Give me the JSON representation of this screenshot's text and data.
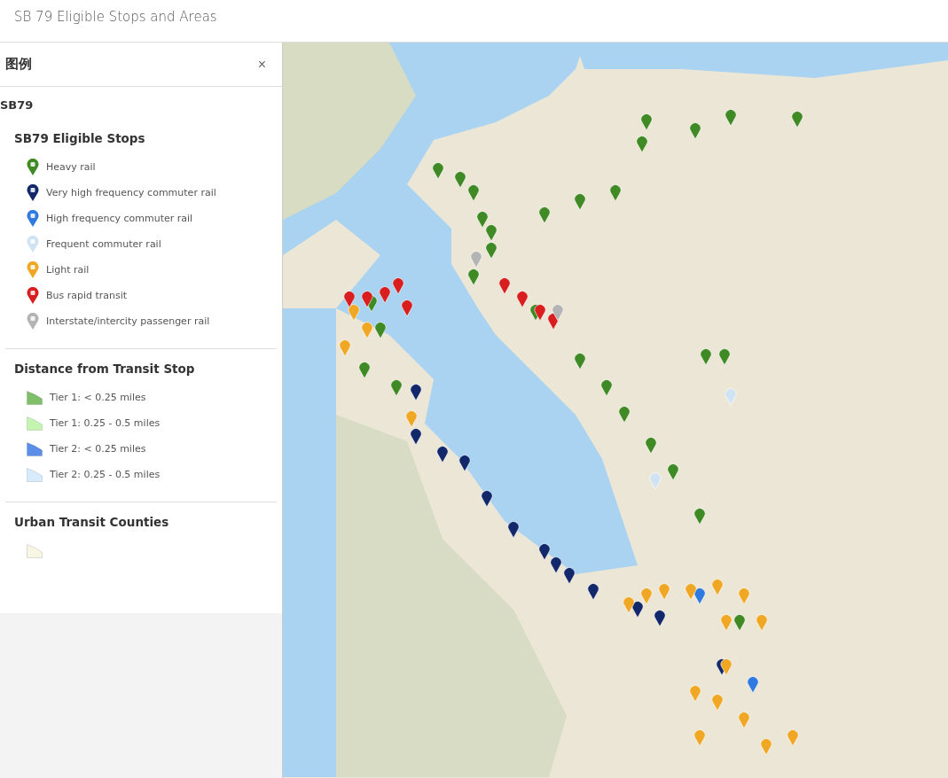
{
  "app_title": "SB 79 Eligible Stops and Areas",
  "legend": {
    "title": "图例",
    "close": "×",
    "layer": "SB79",
    "sections": [
      {
        "title": "SB79 Eligible Stops",
        "items": [
          {
            "kind": "pin",
            "label": "Heavy rail",
            "color": "#3f8a25"
          },
          {
            "kind": "pin",
            "label": "Very high frequency commuter rail",
            "color": "#12286b"
          },
          {
            "kind": "pin",
            "label": "High frequency commuter rail",
            "color": "#2f7ae0"
          },
          {
            "kind": "pin",
            "label": "Frequent commuter rail",
            "color": "#cfe3f2"
          },
          {
            "kind": "pin",
            "label": "Light rail",
            "color": "#f0a824"
          },
          {
            "kind": "pin",
            "label": "Bus rapid transit",
            "color": "#d81e1e"
          },
          {
            "kind": "pin",
            "label": "Interstate/intercity passenger rail",
            "color": "#b4b4b4"
          }
        ]
      },
      {
        "title": "Distance from Transit Stop",
        "items": [
          {
            "kind": "area",
            "label": "Tier 1: < 0.25 miles",
            "color": "#7fbf6a"
          },
          {
            "kind": "area",
            "label": "Tier 1: 0.25 - 0.5 miles",
            "color": "#c3f5b0"
          },
          {
            "kind": "area",
            "label": "Tier 2: < 0.25 miles",
            "color": "#5b8ee8"
          },
          {
            "kind": "area",
            "label": "Tier 2: 0.25 - 0.5 miles",
            "color": "#d6ebfb"
          }
        ]
      },
      {
        "title": "Urban Transit Counties",
        "items": [
          {
            "kind": "area",
            "color": "#f7f5e4"
          }
        ]
      }
    ]
  }
}
